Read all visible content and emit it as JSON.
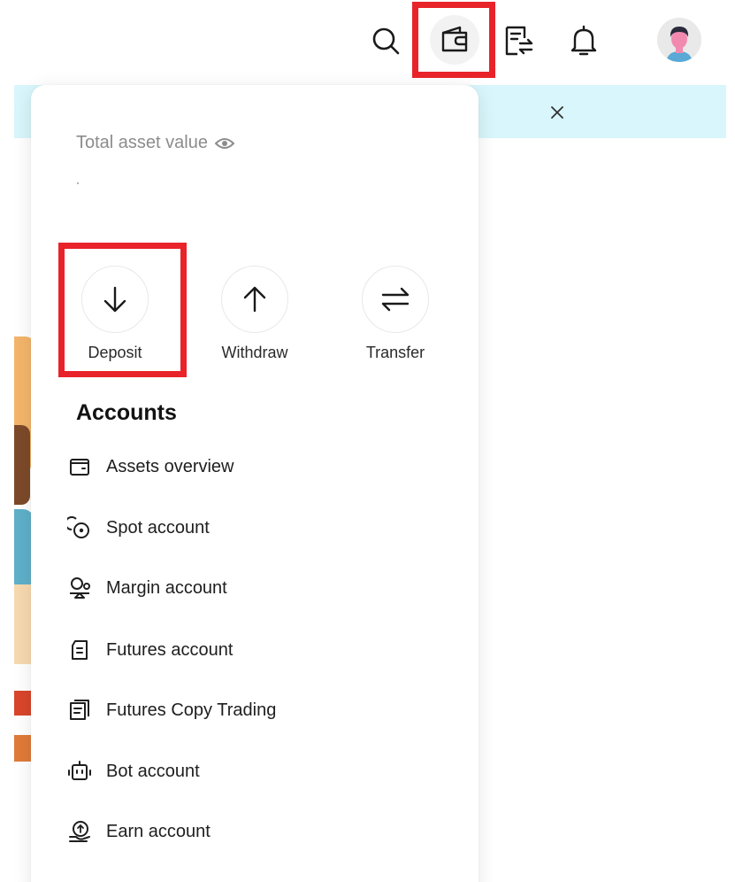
{
  "topbar": {
    "icons": [
      "search-icon",
      "wallet-icon",
      "orders-icon",
      "bell-icon"
    ],
    "accent_color": "#e8232a"
  },
  "panel": {
    "asset_label": "Total asset value",
    "actions": [
      {
        "label": "Deposit",
        "icon": "arrow-down-icon"
      },
      {
        "label": "Withdraw",
        "icon": "arrow-up-icon"
      },
      {
        "label": "Transfer",
        "icon": "transfer-icon"
      }
    ],
    "accounts_title": "Accounts",
    "accounts": [
      {
        "label": "Assets overview",
        "icon": "wallet-outline-icon"
      },
      {
        "label": "Spot account",
        "icon": "coins-icon"
      },
      {
        "label": "Margin account",
        "icon": "margin-icon"
      },
      {
        "label": "Futures account",
        "icon": "futures-icon"
      },
      {
        "label": "Futures Copy Trading",
        "icon": "copy-trading-icon"
      },
      {
        "label": "Bot account",
        "icon": "bot-icon"
      },
      {
        "label": "Earn account",
        "icon": "earn-icon"
      }
    ]
  },
  "banner": {
    "color": "#d8f6fb"
  }
}
